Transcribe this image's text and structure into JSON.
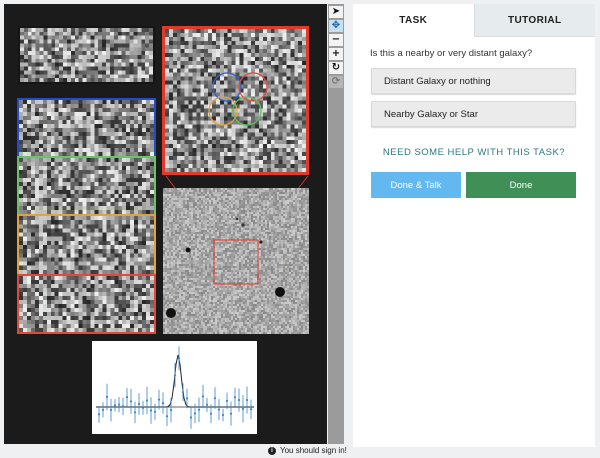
{
  "toolbar": {
    "tools": [
      {
        "icon": "pointer-icon",
        "glyph": "➤"
      },
      {
        "icon": "move-icon",
        "glyph": "✥"
      },
      {
        "icon": "zoom-out-icon",
        "glyph": "−"
      },
      {
        "icon": "zoom-in-icon",
        "glyph": "+"
      },
      {
        "icon": "rotate-icon",
        "glyph": "↻"
      },
      {
        "icon": "reset-icon",
        "glyph": "⟳"
      }
    ]
  },
  "subject": {
    "strip_colors": [
      "#1a1a1a",
      "#1f4fc8",
      "#68c36a",
      "#e3a13a",
      "#e04a3a"
    ],
    "zoom_frame_color": "#e23a2a",
    "circle_colors": [
      "#2f5fd0",
      "#e04a3a",
      "#e3a13a",
      "#5ac05a"
    ]
  },
  "tabs": {
    "task": "TASK",
    "tutorial": "TUTORIAL"
  },
  "task": {
    "question": "Is this a nearby or very distant galaxy?",
    "answers": [
      "Distant Galaxy or nothing",
      "Nearby Galaxy or Star"
    ],
    "help_link": "NEED SOME HELP WITH THIS TASK?",
    "done_talk": "Done & Talk",
    "done": "Done"
  },
  "colors": {
    "done_talk_bg": "#62b8ef",
    "done_bg": "#3f8f57",
    "help_link": "#2e7a86"
  },
  "status": {
    "sign_in": "You should sign in!"
  }
}
